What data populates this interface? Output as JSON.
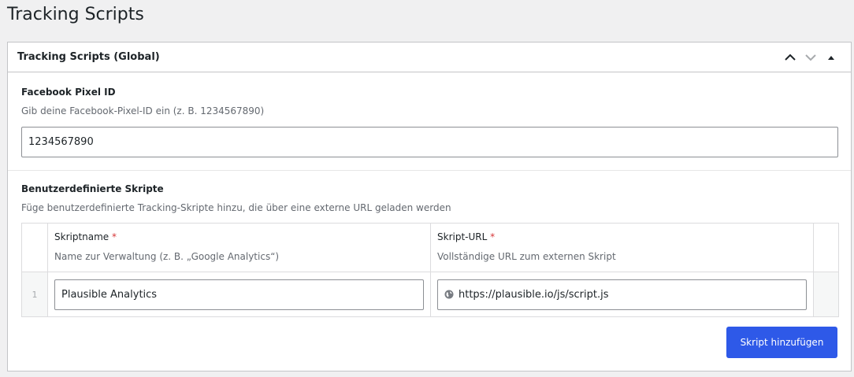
{
  "page": {
    "title": "Tracking Scripts"
  },
  "postbox": {
    "title": "Tracking Scripts (Global)",
    "icons": [
      "chevron-up-icon",
      "chevron-down-icon",
      "triangle-up-icon"
    ]
  },
  "facebook": {
    "label": "Facebook Pixel ID",
    "description": "Gib deine Facebook-Pixel-ID ein (z. B. 1234567890)",
    "value": "1234567890"
  },
  "custom_scripts": {
    "label": "Benutzerdefinierte Skripte",
    "description": "Füge benutzerdefinierte Tracking-Skripte hinzu, die über eine externe URL geladen werden",
    "columns": [
      {
        "label": "Skriptname",
        "required": "*",
        "description": "Name zur Verwaltung (z. B. „Google Analytics“)"
      },
      {
        "label": "Skript-URL",
        "required": "*",
        "description": "Vollständige URL zum externen Skript"
      }
    ],
    "rows": [
      {
        "order": "1",
        "name": "Plausible Analytics",
        "url": "https://plausible.io/js/script.js"
      }
    ],
    "add_button": "Skript hinzufügen"
  },
  "colors": {
    "accent": "#2e59e8",
    "required": "#d63638",
    "border": "#c3c4c7",
    "muted": "#646970"
  }
}
